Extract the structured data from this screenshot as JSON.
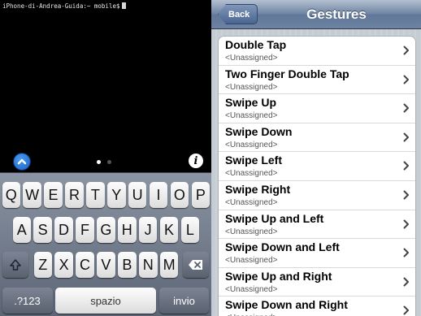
{
  "terminal": {
    "prompt": "iPhone-di-Andrea-Guida:~ mobile$"
  },
  "toolbar": {
    "chevron_icon": "chevron-up-icon",
    "info_icon": "info-icon",
    "info_glyph": "i",
    "page_count": 2,
    "active_page": 1
  },
  "keyboard": {
    "row1": [
      "Q",
      "W",
      "E",
      "R",
      "T",
      "Y",
      "U",
      "I",
      "O",
      "P"
    ],
    "row2": [
      "A",
      "S",
      "D",
      "F",
      "G",
      "H",
      "J",
      "K",
      "L"
    ],
    "row3": [
      "Z",
      "X",
      "C",
      "V",
      "B",
      "N",
      "M"
    ],
    "shift_icon": "shift-icon",
    "delete_icon": "delete-icon",
    "numbers_label": ".?123",
    "space_label": "spazio",
    "return_label": "invio"
  },
  "nav": {
    "back_label": "Back",
    "title": "Gestures"
  },
  "gestures": [
    {
      "title": "Double Tap",
      "value": "<Unassigned>"
    },
    {
      "title": "Two Finger Double Tap",
      "value": "<Unassigned>"
    },
    {
      "title": "Swipe Up",
      "value": "<Unassigned>"
    },
    {
      "title": "Swipe Down",
      "value": "<Unassigned>"
    },
    {
      "title": "Swipe Left",
      "value": "<Unassigned>"
    },
    {
      "title": "Swipe Right",
      "value": "<Unassigned>"
    },
    {
      "title": "Swipe Up and Left",
      "value": "<Unassigned>"
    },
    {
      "title": "Swipe Down and Left",
      "value": "<Unassigned>"
    },
    {
      "title": "Swipe Up and Right",
      "value": "<Unassigned>"
    },
    {
      "title": "Swipe Down and Right",
      "value": "<Unassigned>"
    }
  ],
  "colors": {
    "nav_bar": "#6d83a1",
    "list_background": "#c5ccd4",
    "keyboard": "#6f7888",
    "accent_blue": "#1d5fc4"
  }
}
